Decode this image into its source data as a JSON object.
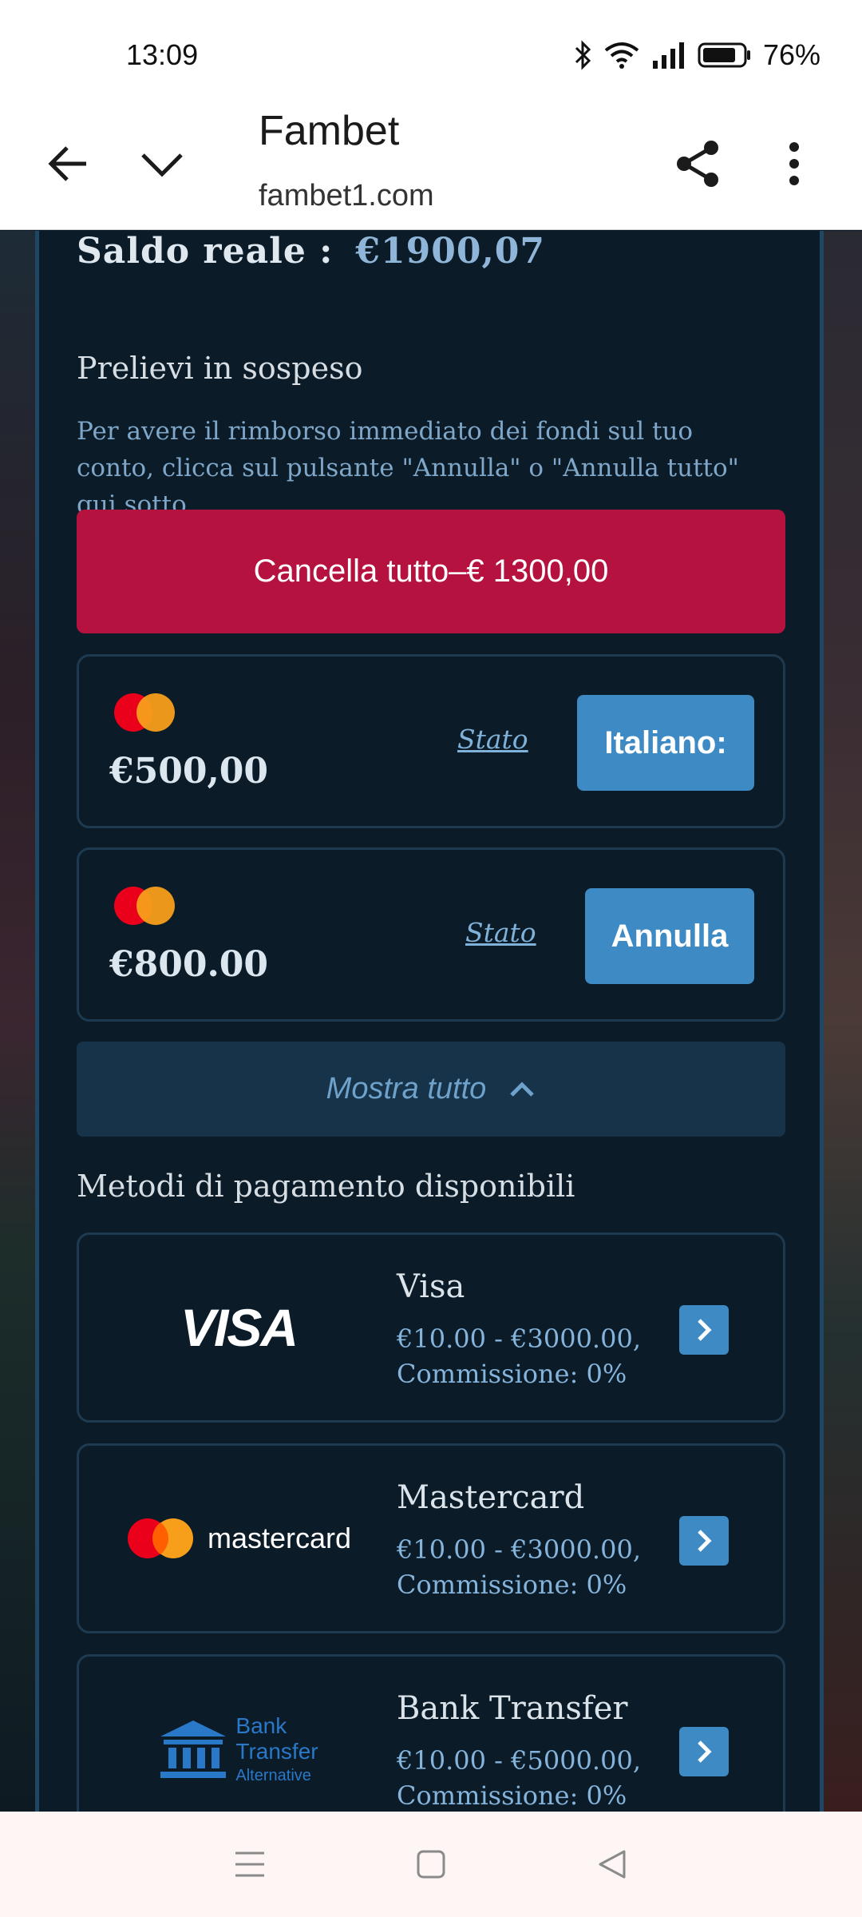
{
  "status_bar": {
    "time": "13:09",
    "battery": "76%"
  },
  "browser": {
    "title": "Fambet",
    "url": "fambet1.com"
  },
  "balance": {
    "label": "Saldo reale :",
    "amount": "€1900,07"
  },
  "pending": {
    "title": "Prelievi in sospeso",
    "info": "Per avere il rimborso immediato dei fondi sul tuo conto, clicca sul pulsante \"Annulla\" o \"Annulla tutto\" qui sotto.",
    "cancel_all_label": "Cancella tutto–€ 1300,00",
    "withdrawals": [
      {
        "amount": "€500,00",
        "status_label": "Stato",
        "action_label": "Italiano:"
      },
      {
        "amount": "€800.00",
        "status_label": "Stato",
        "action_label": "Annulla"
      }
    ],
    "show_all_label": "Mostra tutto"
  },
  "payment_methods": {
    "title": "Metodi di pagamento disponibili",
    "items": [
      {
        "name": "Visa",
        "range": "€10.00 - €3000.00,",
        "commission": "Commissione: 0%",
        "logo_text": "VISA"
      },
      {
        "name": "Mastercard",
        "range": "€10.00 - €3000.00,",
        "commission": "Commissione: 0%",
        "logo_text": "mastercard"
      },
      {
        "name": "Bank Transfer",
        "range": "€10.00 - €5000.00,",
        "commission": "Commissione: 0%",
        "logo_text_1": "Bank",
        "logo_text_2": "Transfer",
        "logo_text_3": "Alternative"
      }
    ]
  },
  "colors": {
    "accent_red": "#b5123f",
    "accent_blue": "#3d8ac4",
    "panel": "#0b1b27"
  }
}
